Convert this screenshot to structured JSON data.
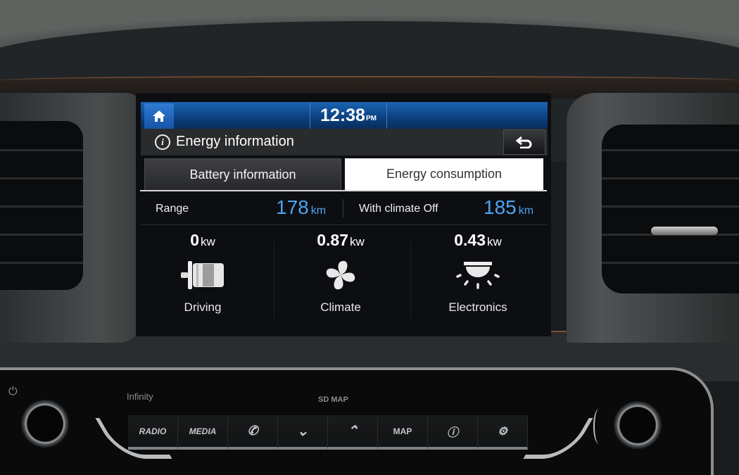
{
  "screen": {
    "status_bar": {
      "home_icon": "home-icon",
      "time": "12:38",
      "ampm": "PM"
    },
    "title_bar": {
      "icon": "info-icon",
      "title": "Energy information",
      "back_icon": "back-arrow-icon",
      "back_glyph": "⮌"
    },
    "tabs": [
      {
        "label": "Battery information",
        "active": false
      },
      {
        "label": "Energy consumption",
        "active": true
      }
    ],
    "range": {
      "label": "Range",
      "value": "178",
      "unit": "km",
      "climate_off_label": "With climate Off",
      "climate_off_value": "185",
      "climate_off_unit": "km"
    },
    "consumption": [
      {
        "value": "0",
        "unit": "kw",
        "label": "Driving",
        "icon": "motor-icon"
      },
      {
        "value": "0.87",
        "unit": "kw",
        "label": "Climate",
        "icon": "fan-icon"
      },
      {
        "value": "0.43",
        "unit": "kw",
        "label": "Electronics",
        "icon": "ceiling-light-icon"
      }
    ],
    "accent_color": "#4da3f0"
  },
  "console": {
    "power_glyph": "⏻",
    "brand": "Infinity",
    "sd_map": "SD MAP",
    "buttons": [
      {
        "label": "RADIO"
      },
      {
        "label": "MEDIA"
      },
      {
        "label": "",
        "icon": "phone-icon",
        "glyph": "✆"
      },
      {
        "label": "",
        "icon": "chevron-down-icon",
        "glyph": "⌄"
      },
      {
        "label": "",
        "icon": "chevron-up-icon",
        "glyph": "⌃"
      },
      {
        "label": "MAP"
      },
      {
        "label": "",
        "icon": "info-icon",
        "glyph": "ⓘ"
      },
      {
        "label": "",
        "icon": "gear-icon",
        "glyph": "⚙"
      }
    ]
  }
}
